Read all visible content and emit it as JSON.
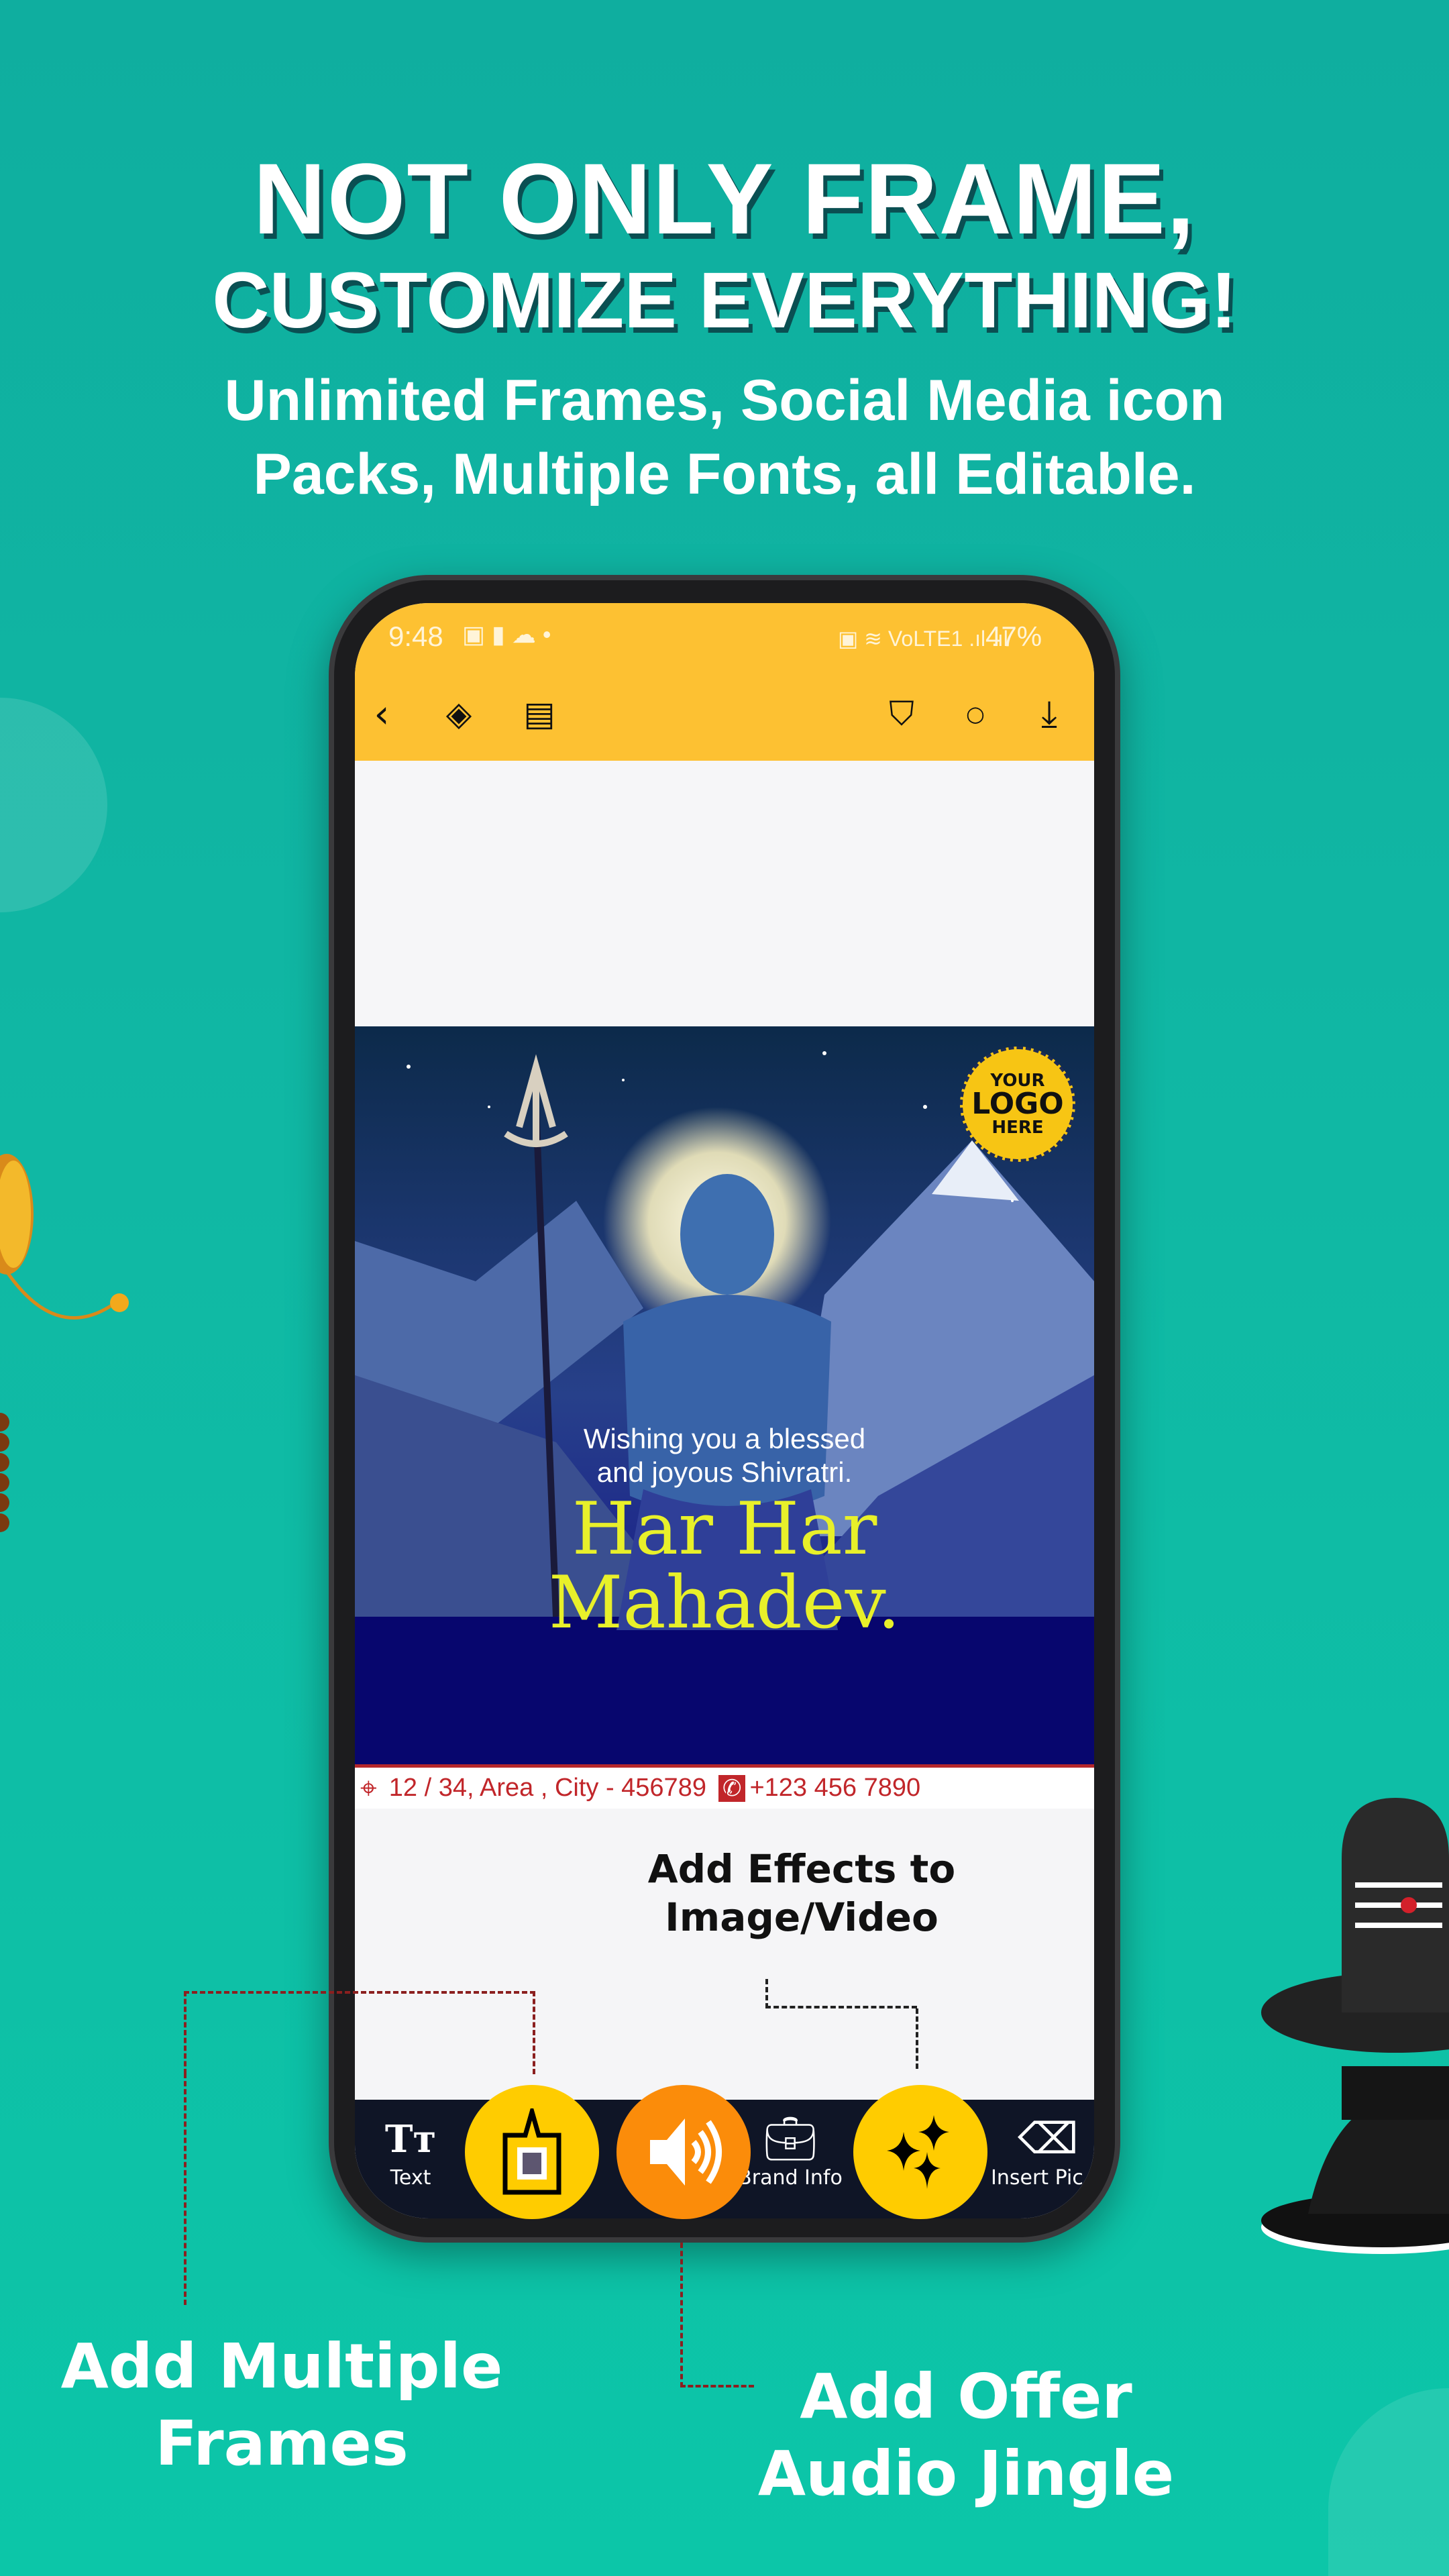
{
  "headline": {
    "line1": "NOT ONLY FRAME,",
    "line2": "CUSTOMIZE EVERYTHING!"
  },
  "subtitle": {
    "line1": "Unlimited Frames, Social Media icon",
    "line2": "Packs, Multiple Fonts, all Editable."
  },
  "status_bar": {
    "time": "9:48",
    "network": "VoLTE1",
    "battery": "47%"
  },
  "toolbar": {
    "icons": [
      "back-icon",
      "layers-icon",
      "save-icon",
      "bookmark-icon",
      "circle-icon",
      "download-icon"
    ]
  },
  "artwork": {
    "logo": {
      "line1": "YOUR",
      "line2": "LOGO",
      "line3": "HERE"
    },
    "greeting": {
      "line1": "Wishing you a blessed",
      "line2": "and joyous Shivratri."
    },
    "title": {
      "line1": "Har Har",
      "line2": "Mahadev."
    },
    "title_color": "#e8f02a"
  },
  "contact": {
    "address": "12 / 34, Area , City - 456789",
    "phone": "+123 456 7890"
  },
  "bottom_nav": {
    "text": "Text",
    "brand_info": "Brand Info",
    "insert_pic": "Insert Pic"
  },
  "callouts": {
    "effects": {
      "line1": "Add Effects to",
      "line2": "Image/Video"
    },
    "frames": {
      "line1": "Add Multiple",
      "line2": "Frames"
    },
    "audio": {
      "line1": "Add Offer",
      "line2": "Audio Jingle"
    }
  },
  "colors": {
    "background": "#10b8a4",
    "topbar": "#fdc132",
    "fab_yellow": "#ffcc00",
    "fab_orange": "#fb8c0a",
    "navbar": "#0f1526"
  }
}
